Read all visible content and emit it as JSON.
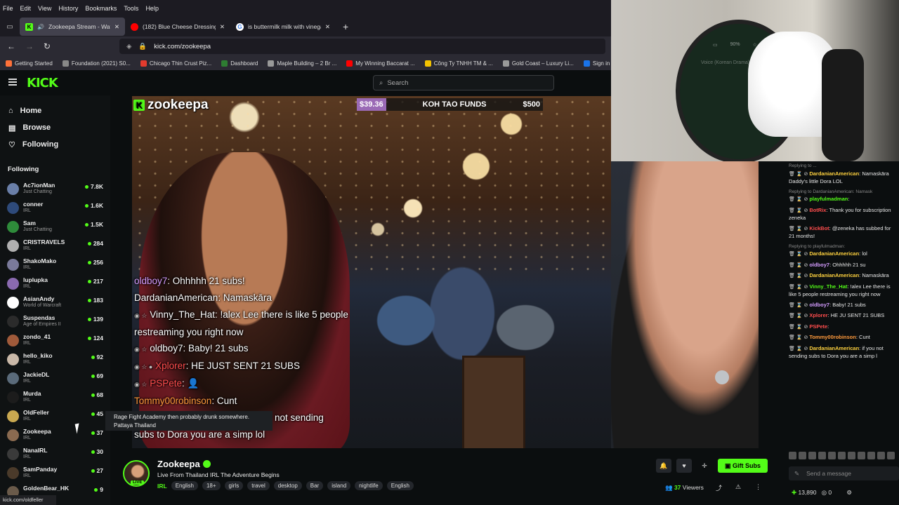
{
  "browser": {
    "menu": [
      "File",
      "Edit",
      "View",
      "History",
      "Bookmarks",
      "Tools",
      "Help"
    ],
    "tabs": [
      {
        "title": "Zookeepa Stream - Watch Li",
        "color": "#53fc18"
      },
      {
        "title": "(182) Blue Cheese Dressing - Cl",
        "color": "#ff0000"
      },
      {
        "title": "is buttermilk milk with vinegar",
        "color": "#4285f4"
      }
    ],
    "url": "kick.com/zookeepa",
    "bookmarks": [
      {
        "label": "Getting Started",
        "color": "#ff7139"
      },
      {
        "label": "Foundation (2021) S0...",
        "color": "#888888"
      },
      {
        "label": "Chicago Thin Crust Piz...",
        "color": "#e23b2e"
      },
      {
        "label": "Dashboard",
        "color": "#2e7d32"
      },
      {
        "label": "Maple Building – 2 Br ...",
        "color": "#999999"
      },
      {
        "label": "My Winning Baccarat ...",
        "color": "#ff0000"
      },
      {
        "label": "Công Ty TNHH TM & ...",
        "color": "#f2c200"
      },
      {
        "label": "Gold Coast – Luxury Li...",
        "color": "#999999"
      },
      {
        "label": "Sign in - Drea",
        "color": "#1a73e8"
      }
    ],
    "status_url": "kick.com/oldfeller"
  },
  "kick": {
    "logo": "KICK",
    "search_placeholder": "Search",
    "nav": [
      {
        "label": "Home",
        "icon": "home-icon"
      },
      {
        "label": "Browse",
        "icon": "browse-icon"
      },
      {
        "label": "Following",
        "icon": "heart-icon"
      }
    ],
    "following_title": "Following",
    "following": [
      {
        "name": "Ac7ionMan",
        "category": "Just Chatting",
        "viewers": "7.8K",
        "color": "#6a7fa8"
      },
      {
        "name": "conner",
        "category": "IRL",
        "viewers": "1.6K",
        "color": "#2e4a7a"
      },
      {
        "name": "Sam",
        "category": "Just Chatting",
        "viewers": "1.5K",
        "color": "#2e8b3a"
      },
      {
        "name": "CRISTRAVELS",
        "category": "IRL",
        "viewers": "284",
        "color": "#b0b0b0"
      },
      {
        "name": "ShakoMako",
        "category": "IRL",
        "viewers": "256",
        "color": "#7a7a9a"
      },
      {
        "name": "luplupka",
        "category": "IRL",
        "viewers": "217",
        "color": "#8a6ab0"
      },
      {
        "name": "AsianAndy",
        "category": "World of Warcraft",
        "viewers": "183",
        "color": "#ffffff"
      },
      {
        "name": "Suspendas",
        "category": "Age of Empires II",
        "viewers": "139",
        "color": "#2b2b2b"
      },
      {
        "name": "zondo_41",
        "category": "IRL",
        "viewers": "124",
        "color": "#a05a3a"
      },
      {
        "name": "hello_kiko",
        "category": "IRL",
        "viewers": "92",
        "color": "#c9b8a8"
      },
      {
        "name": "JackieDL",
        "category": "IRL",
        "viewers": "69",
        "color": "#5a6a7a"
      },
      {
        "name": "Murda",
        "category": "IRL",
        "viewers": "68",
        "color": "#1c1c1c"
      },
      {
        "name": "OldFeller",
        "category": "IRL",
        "viewers": "45",
        "color": "#c9a850"
      },
      {
        "name": "Zookeepa",
        "category": "IRL",
        "viewers": "37",
        "color": "#8a6a50"
      },
      {
        "name": "NanaIRL",
        "category": "IRL",
        "viewers": "30",
        "color": "#3a3a3a"
      },
      {
        "name": "SamPanday",
        "category": "IRL",
        "viewers": "27",
        "color": "#4a3a2a"
      },
      {
        "name": "GoldenBear_HK",
        "category": "",
        "viewers": "9",
        "color": "#6a5a4a"
      }
    ],
    "tooltip": "Rage Fight Academy then probably drunk somewhere. Pattaya Thailand"
  },
  "video": {
    "brand": "zookeepa",
    "funds": {
      "raised": "$39.36",
      "label": "KOH TAO FUNDS",
      "goal": "$500"
    },
    "chat": [
      {
        "user": "oldboy7",
        "text": ": Ohhhhh 21 subs!",
        "color": "#d49cff",
        "badges": ""
      },
      {
        "user": "DardanianAmerican",
        "text": ": Namaskāra",
        "color": "#ffffff",
        "badges": ""
      },
      {
        "user": "Vinny_The_Hat",
        "text": ": !alex Lee there is like 5 people restreaming you right now",
        "color": "#ffffff",
        "badges": "◉ ☆"
      },
      {
        "user": "oldboy7",
        "text": ": Baby! 21 subs",
        "color": "#ffffff",
        "badges": "◉ ☆"
      },
      {
        "user": "Xplorer",
        "text": ": HE JUST SENT 21 SUBS",
        "color": "#ff4d4d",
        "badges": "◉ ☆ ●"
      },
      {
        "user": "PSPete",
        "text": ": 👤",
        "color": "#ff4d4d",
        "badges": "◉ ☆"
      },
      {
        "user": "Tommy00robinson",
        "text": ": Cunt",
        "color": "#ff9a3c",
        "badges": ""
      },
      {
        "user": "",
        "text": "not sending",
        "color": "#ffffff",
        "badges": ""
      },
      {
        "user": "",
        "text": "subs to Dora you are a simp lol",
        "color": "#ffffff",
        "badges": ""
      }
    ]
  },
  "webcam": {
    "ui_zoom": "90%",
    "ui_title": "Voice (Korean Drama)"
  },
  "chat": {
    "messages": [
      {
        "reply": "Replying to ...",
        "user": "DardanianAmerican",
        "text": "Namaskāra Daddy's little Dora LOL",
        "color": "#ffd23f"
      },
      {
        "reply": "Replying to DardanianAmerican: Namask",
        "user": "playfulmadman",
        "text": "",
        "color": "#53fc18"
      },
      {
        "reply": "",
        "user": "BotRix",
        "text": "Thank you for subscription zeneka",
        "color": "#ff4d4d"
      },
      {
        "reply": "",
        "user": "KickBot",
        "text": "@zeneka has subbed for 21 months!",
        "color": "#ff4d4d"
      },
      {
        "reply": "Replying to playfulmadman:",
        "user": "DardanianAmerican",
        "text": "lol",
        "color": "#ffd23f"
      },
      {
        "reply": "",
        "user": "oldboy7",
        "text": "Ohhhhh 21 su",
        "color": "#d49cff"
      },
      {
        "reply": "",
        "user": "DardanianAmerican",
        "text": "Namaskāra",
        "color": "#ffd23f"
      },
      {
        "reply": "",
        "user": "Vinny_The_Hat",
        "text": "!alex Lee there is like 5 people restreaming you right now",
        "color": "#53fc18"
      },
      {
        "reply": "",
        "user": "oldboy7",
        "text": "Baby! 21 subs",
        "color": "#d49cff"
      },
      {
        "reply": "",
        "user": "Xplorer",
        "text": "HE JU SENT 21 SUBS",
        "color": "#ff4d4d"
      },
      {
        "reply": "",
        "user": "PSPete",
        "text": "",
        "color": "#ff4d4d"
      },
      {
        "reply": "",
        "user": "Tommy00robinson",
        "text": "Cunt",
        "color": "#ff9a3c"
      },
      {
        "reply": "",
        "user": "DardanianAmerican",
        "text": "if you not sending subs to Dora you are a simp l",
        "color": "#ffd23f"
      }
    ],
    "input_placeholder": "Send a message",
    "points": "13,890",
    "points_zero": "0"
  },
  "streamer": {
    "name": "Zookeepa",
    "live_label": "LIVE",
    "title": "Live From Thailand IRL The Adventure Begins",
    "category": "IRL",
    "tags": [
      "English",
      "18+",
      "girls",
      "travel",
      "desktop",
      "Bar",
      "island",
      "nightlife",
      "English"
    ],
    "viewers": "37",
    "viewers_label": "Viewers",
    "gift_label": "Gift Subs"
  }
}
